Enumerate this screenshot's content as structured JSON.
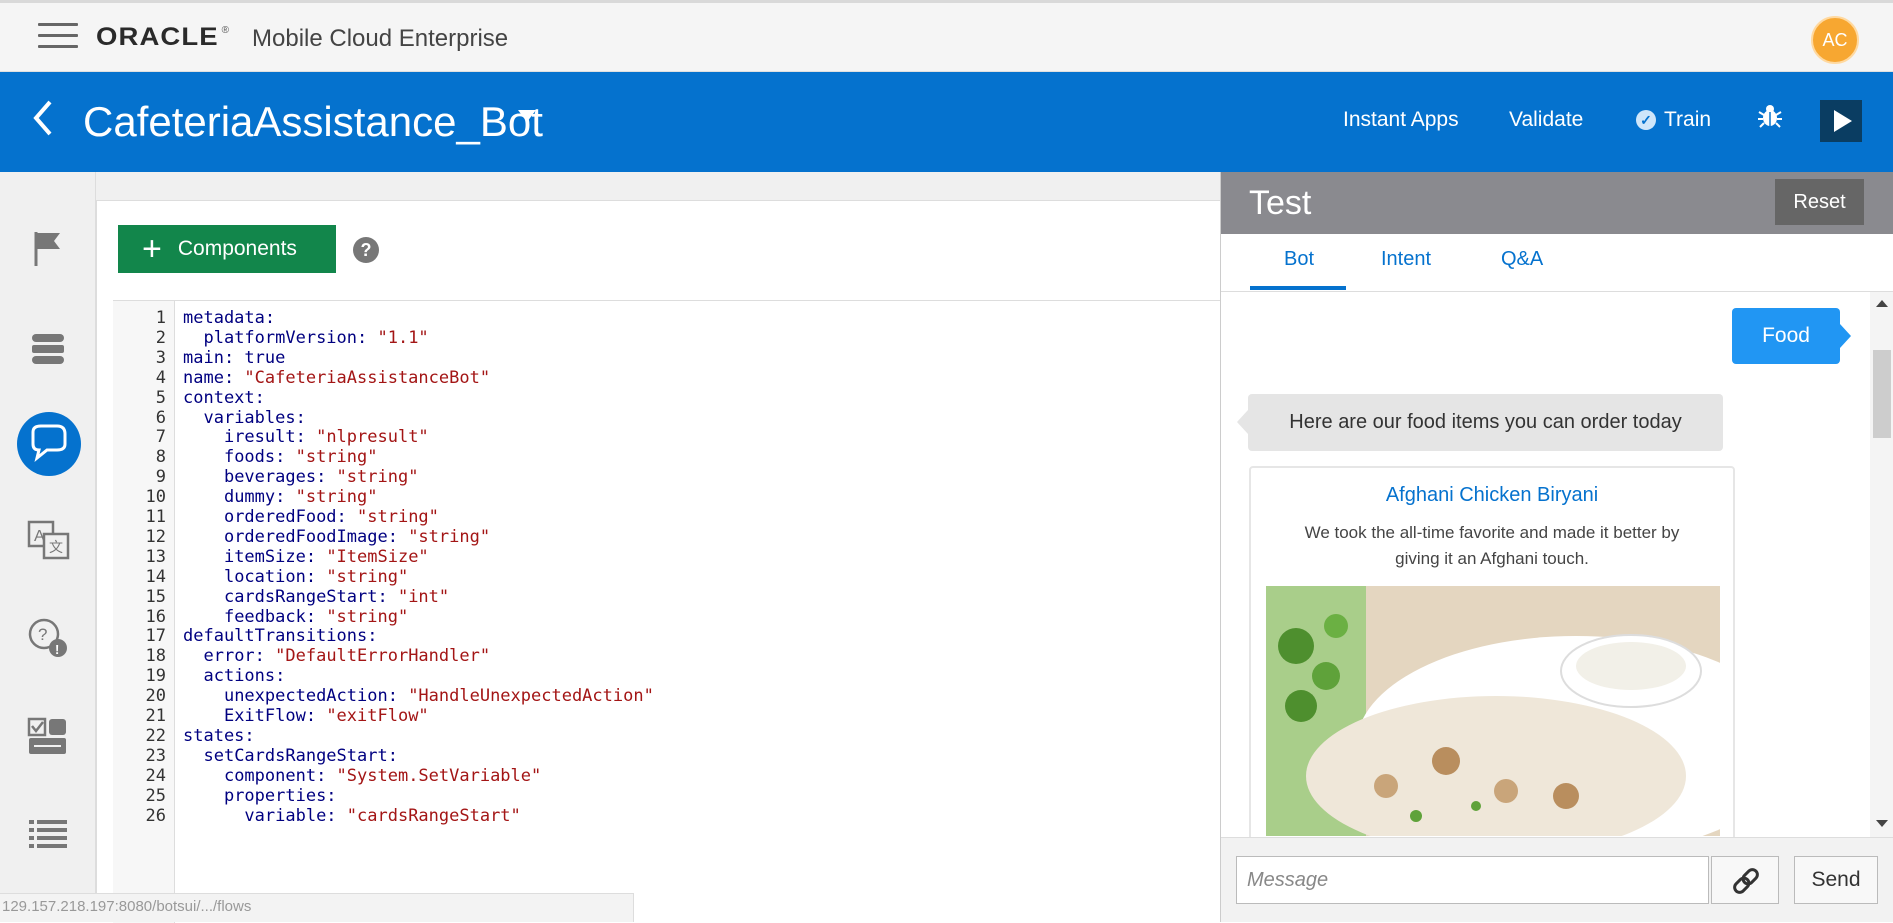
{
  "topbar": {
    "logo_word": "ORACLE",
    "logo_reg": "®",
    "product": "Mobile Cloud Enterprise",
    "avatar_initials": "AC"
  },
  "header": {
    "bot_name": "CafeteriaAssistance_Bot",
    "nav": {
      "instant_apps": "Instant Apps",
      "validate": "Validate",
      "train": "Train"
    }
  },
  "editor": {
    "components_label": "Components",
    "help_label": "?",
    "lines": [
      {
        "n": "1",
        "ind": "",
        "key": "metadata:",
        "val": ""
      },
      {
        "n": "2",
        "ind": "  ",
        "key": "platformVersion: ",
        "val": "\"1.1\""
      },
      {
        "n": "3",
        "ind": "",
        "key": "main: true",
        "val": ""
      },
      {
        "n": "4",
        "ind": "",
        "key": "name: ",
        "val": "\"CafeteriaAssistanceBot\""
      },
      {
        "n": "5",
        "ind": "",
        "key": "context:",
        "val": ""
      },
      {
        "n": "6",
        "ind": "  ",
        "key": "variables:",
        "val": ""
      },
      {
        "n": "7",
        "ind": "    ",
        "key": "iresult: ",
        "val": "\"nlpresult\""
      },
      {
        "n": "8",
        "ind": "    ",
        "key": "foods: ",
        "val": "\"string\""
      },
      {
        "n": "9",
        "ind": "    ",
        "key": "beverages: ",
        "val": "\"string\""
      },
      {
        "n": "10",
        "ind": "    ",
        "key": "dummy: ",
        "val": "\"string\""
      },
      {
        "n": "11",
        "ind": "    ",
        "key": "orderedFood: ",
        "val": "\"string\""
      },
      {
        "n": "12",
        "ind": "    ",
        "key": "orderedFoodImage: ",
        "val": "\"string\""
      },
      {
        "n": "13",
        "ind": "    ",
        "key": "itemSize: ",
        "val": "\"ItemSize\""
      },
      {
        "n": "14",
        "ind": "    ",
        "key": "location: ",
        "val": "\"string\""
      },
      {
        "n": "15",
        "ind": "    ",
        "key": "cardsRangeStart: ",
        "val": "\"int\""
      },
      {
        "n": "16",
        "ind": "    ",
        "key": "feedback: ",
        "val": "\"string\""
      },
      {
        "n": "17",
        "ind": "",
        "key": "defaultTransitions:",
        "val": ""
      },
      {
        "n": "18",
        "ind": "  ",
        "key": "error: ",
        "val": "\"DefaultErrorHandler\""
      },
      {
        "n": "19",
        "ind": "  ",
        "key": "actions:",
        "val": ""
      },
      {
        "n": "20",
        "ind": "    ",
        "key": "unexpectedAction: ",
        "val": "\"HandleUnexpectedAction\""
      },
      {
        "n": "21",
        "ind": "    ",
        "key": "ExitFlow: ",
        "val": "\"exitFlow\""
      },
      {
        "n": "22",
        "ind": "",
        "key": "states:",
        "val": ""
      },
      {
        "n": "23",
        "ind": "  ",
        "key": "setCardsRangeStart:",
        "val": ""
      },
      {
        "n": "24",
        "ind": "    ",
        "key": "component: ",
        "val": "\"System.SetVariable\""
      },
      {
        "n": "25",
        "ind": "    ",
        "key": "properties:",
        "val": ""
      },
      {
        "n": "26",
        "ind": "      ",
        "key": "variable: ",
        "val": "\"cardsRangeStart\""
      }
    ]
  },
  "status_url": "129.157.218.197:8080/botsui/.../flows",
  "test": {
    "title": "Test",
    "reset_label": "Reset",
    "tabs": [
      "Bot",
      "Intent",
      "Q&A"
    ],
    "user_message": "Food",
    "bot_message": "Here are our food items you can order today",
    "card": {
      "title": "Afghani Chicken Biryani",
      "description": "We took the all-time favorite and made it better by giving it an Afghani touch."
    },
    "message_placeholder": "Message",
    "send_label": "Send"
  },
  "colors": {
    "brand_blue": "#0572ce",
    "components_green": "#12864b",
    "avatar_orange": "#f7a731",
    "test_header_gray": "#8a8a8f"
  },
  "icons": [
    "hamburger-icon",
    "back-chevron-icon",
    "dropdown-caret-icon",
    "check-circle-icon",
    "bug-icon",
    "play-icon",
    "flag-icon",
    "database-icon",
    "chat-icon",
    "translate-icon",
    "faq-icon",
    "checklist-icon",
    "list-icon",
    "link-icon"
  ]
}
